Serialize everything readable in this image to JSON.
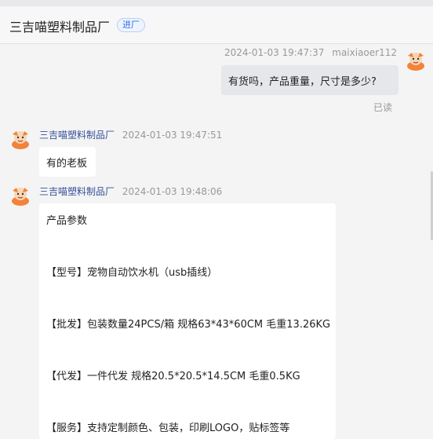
{
  "header": {
    "shop_name": "三吉喵塑料制品厂",
    "enter_label": "进厂"
  },
  "messages": [
    {
      "sender": "maixiaoer112",
      "time": "2024-01-03 19:47:37",
      "text": "有货吗，产品重量，尺寸是多少?",
      "status": "已读"
    },
    {
      "sender": "三吉喵塑料制品厂",
      "time": "2024-01-03 19:47:51",
      "text": "有的老板"
    },
    {
      "sender": "三吉喵塑料制品厂",
      "time": "2024-01-03 19:48:06",
      "lines": [
        "产品参数",
        "【型号】宠物自动饮水机（usb插线）",
        "【批发】包装数量24PCS/箱 规格63*43*60CM 毛重13.26KG",
        "【代发】一件代发 规格20.5*20.5*14.5CM 毛重0.5KG",
        "【服务】支持定制颜色、包装，印刷LOGO，贴标签等"
      ]
    }
  ],
  "icons": {
    "avatar": "cartoon-mascot-icon"
  },
  "colors": {
    "accent": "#2f6fe0",
    "avatar_orange": "#f2833a"
  }
}
